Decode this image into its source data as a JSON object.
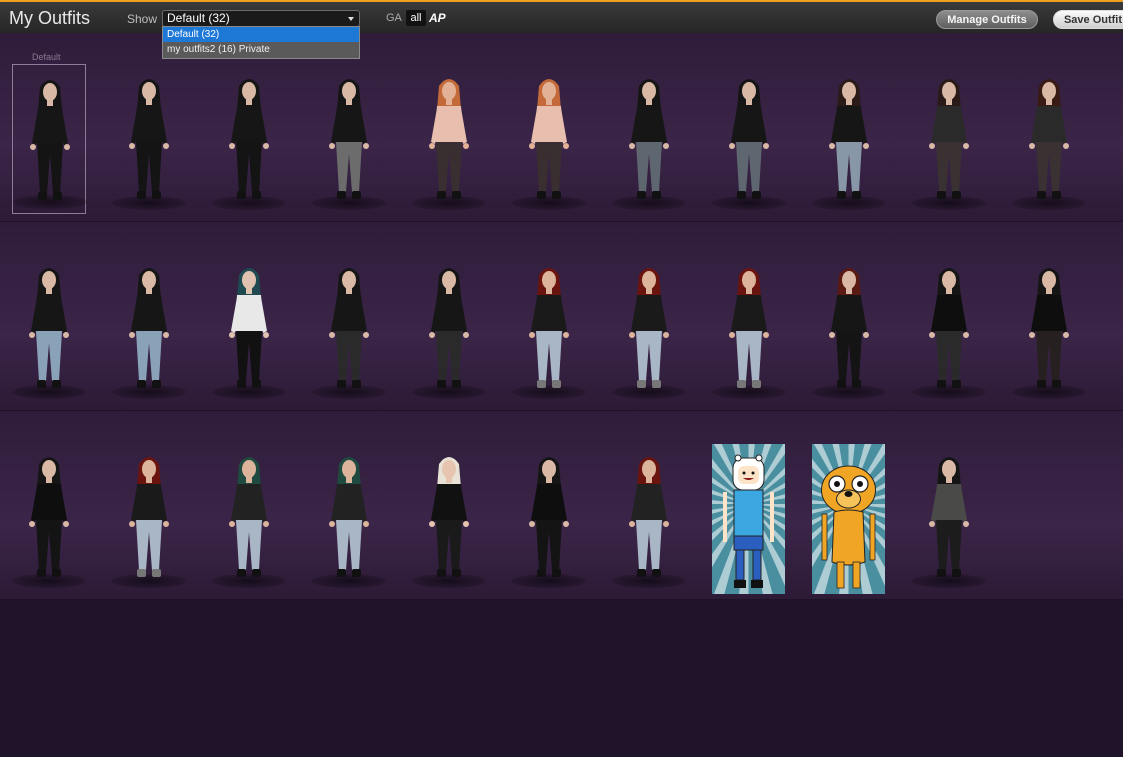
{
  "header": {
    "title": "My Outfits",
    "show_label": "Show",
    "select_value": "Default (32)",
    "ga_label": "GA",
    "all_label": "all",
    "ap_label": "AP",
    "manage_button": "Manage Outfits",
    "save_button": "Save Outfit"
  },
  "dropdown": {
    "options": [
      "Default (32)",
      "my outfits2 (16) Private"
    ],
    "selected_index": 0
  },
  "grid": {
    "default_label": "Default",
    "rows": [
      [
        {
          "hair": "#151515",
          "skin": "#d9b9a6",
          "top": "#161616",
          "pants": "#141414",
          "shoe": "#111"
        },
        {
          "hair": "#151515",
          "skin": "#d9b9a6",
          "top": "#161616",
          "pants": "#141414",
          "shoe": "#111"
        },
        {
          "hair": "#151515",
          "skin": "#d9b9a6",
          "top": "#161616",
          "pants": "#141414",
          "shoe": "#111"
        },
        {
          "hair": "#151515",
          "skin": "#d9b9a6",
          "top": "#161616",
          "pants": "#6c6c6c",
          "shoe": "#111"
        },
        {
          "hair": "#c46a3a",
          "skin": "#e3b196",
          "top": "#e8bfae",
          "pants": "#3a2f30",
          "shoe": "#111"
        },
        {
          "hair": "#c46a3a",
          "skin": "#e3b196",
          "top": "#e8bfae",
          "pants": "#3a2f30",
          "shoe": "#111"
        },
        {
          "hair": "#151515",
          "skin": "#d9b9a6",
          "top": "#161616",
          "pants": "#5e6670",
          "shoe": "#111"
        },
        {
          "hair": "#151515",
          "skin": "#d9b9a6",
          "top": "#161616",
          "pants": "#5e6670",
          "shoe": "#111"
        },
        {
          "hair": "#2a1a18",
          "skin": "#d9b9a6",
          "top": "#161616",
          "pants": "#8797a8",
          "shoe": "#111"
        },
        {
          "hair": "#2a1a18",
          "skin": "#d9b9a6",
          "top": "#2a2a2a",
          "pants": "#3a3232",
          "shoe": "#111"
        },
        {
          "hair": "#3a1a14",
          "skin": "#d9b9a6",
          "top": "#2a2a2a",
          "pants": "#3a3232",
          "shoe": "#111"
        }
      ],
      [
        {
          "hair": "#151515",
          "skin": "#d9b9a6",
          "top": "#161616",
          "pants": "#8aa2b8",
          "shoe": "#111"
        },
        {
          "hair": "#151515",
          "skin": "#d9b9a6",
          "top": "#161616",
          "pants": "#8aa2b8",
          "shoe": "#111"
        },
        {
          "hair": "#1f4a52",
          "skin": "#e0c2b0",
          "top": "#e8e8e8",
          "pants": "#111111",
          "shoe": "#111"
        },
        {
          "hair": "#151515",
          "skin": "#d9b9a6",
          "top": "#161616",
          "pants": "#2a2a2a",
          "shoe": "#111"
        },
        {
          "hair": "#151515",
          "skin": "#d9b9a6",
          "top": "#161616",
          "pants": "#2a2a2a",
          "shoe": "#111"
        },
        {
          "hair": "#6a1410",
          "skin": "#dcb39b",
          "top": "#1a1a1a",
          "pants": "#a8b6c6",
          "shoe": "#777"
        },
        {
          "hair": "#6a1410",
          "skin": "#dcb39b",
          "top": "#1a1a1a",
          "pants": "#a8b6c6",
          "shoe": "#777"
        },
        {
          "hair": "#6a1410",
          "skin": "#dcb39b",
          "top": "#1a1a1a",
          "pants": "#a8b6c6",
          "shoe": "#777"
        },
        {
          "hair": "#5a1a14",
          "skin": "#d9b9a6",
          "top": "#161616",
          "pants": "#141414",
          "shoe": "#111"
        },
        {
          "hair": "#151515",
          "skin": "#d9b9a6",
          "top": "#0e0e0e",
          "pants": "#2a2a2a",
          "shoe": "#111"
        },
        {
          "hair": "#151515",
          "skin": "#d9b9a6",
          "top": "#0e0e0e",
          "pants": "#262020",
          "shoe": "#111"
        }
      ],
      [
        {
          "hair": "#151515",
          "skin": "#d9b9a6",
          "top": "#0e0e0e",
          "pants": "#141414",
          "shoe": "#111"
        },
        {
          "hair": "#6a1410",
          "skin": "#dcb39b",
          "top": "#1a1a1a",
          "pants": "#a8b6c6",
          "shoe": "#777"
        },
        {
          "hair": "#1f4a40",
          "skin": "#dcb39b",
          "top": "#222",
          "pants": "#a8b6c6",
          "shoe": "#111"
        },
        {
          "hair": "#1f4a40",
          "skin": "#dcb39b",
          "top": "#222",
          "pants": "#a8b6c6",
          "shoe": "#111"
        },
        {
          "hair": "#e8e2d6",
          "skin": "#e6c4b0",
          "top": "#111",
          "pants": "#1a1a1a",
          "shoe": "#111"
        },
        {
          "hair": "#151515",
          "skin": "#d9b9a6",
          "top": "#0e0e0e",
          "pants": "#141414",
          "shoe": "#111"
        },
        {
          "hair": "#6a1410",
          "skin": "#dcb39b",
          "top": "#222",
          "pants": "#a8b6c6",
          "shoe": "#111"
        },
        {
          "card": "finn"
        },
        {
          "card": "jake"
        },
        {
          "hair": "#151515",
          "skin": "#d9b9a6",
          "top": "#4a4a48",
          "pants": "#1c1c1c",
          "shoe": "#111"
        }
      ]
    ]
  }
}
